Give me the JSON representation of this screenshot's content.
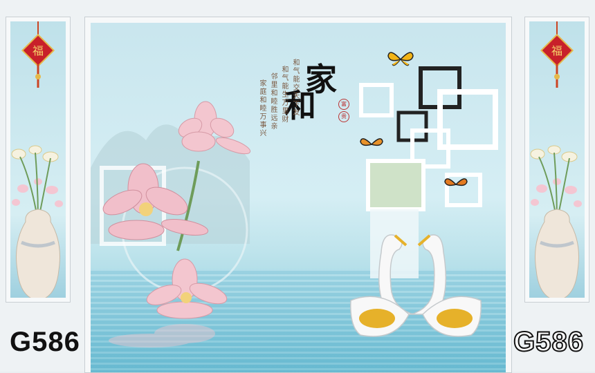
{
  "product_code_left": "G586",
  "product_code_right": "G586",
  "calligraphy": {
    "title_chars": [
      "和",
      "家"
    ],
    "poem_lines": [
      "和气能交天下友",
      "和气能生万里财",
      "邻里和睦胜远亲",
      "家庭和睦万事兴"
    ],
    "seal_chars": [
      "富",
      "贵"
    ]
  },
  "decor": {
    "lantern_char": "福"
  },
  "colors": {
    "sky": "#c9e6ee",
    "water": "#7fc6d8",
    "lotus": "#f3c6cf",
    "frame": "#f6f8f9"
  }
}
